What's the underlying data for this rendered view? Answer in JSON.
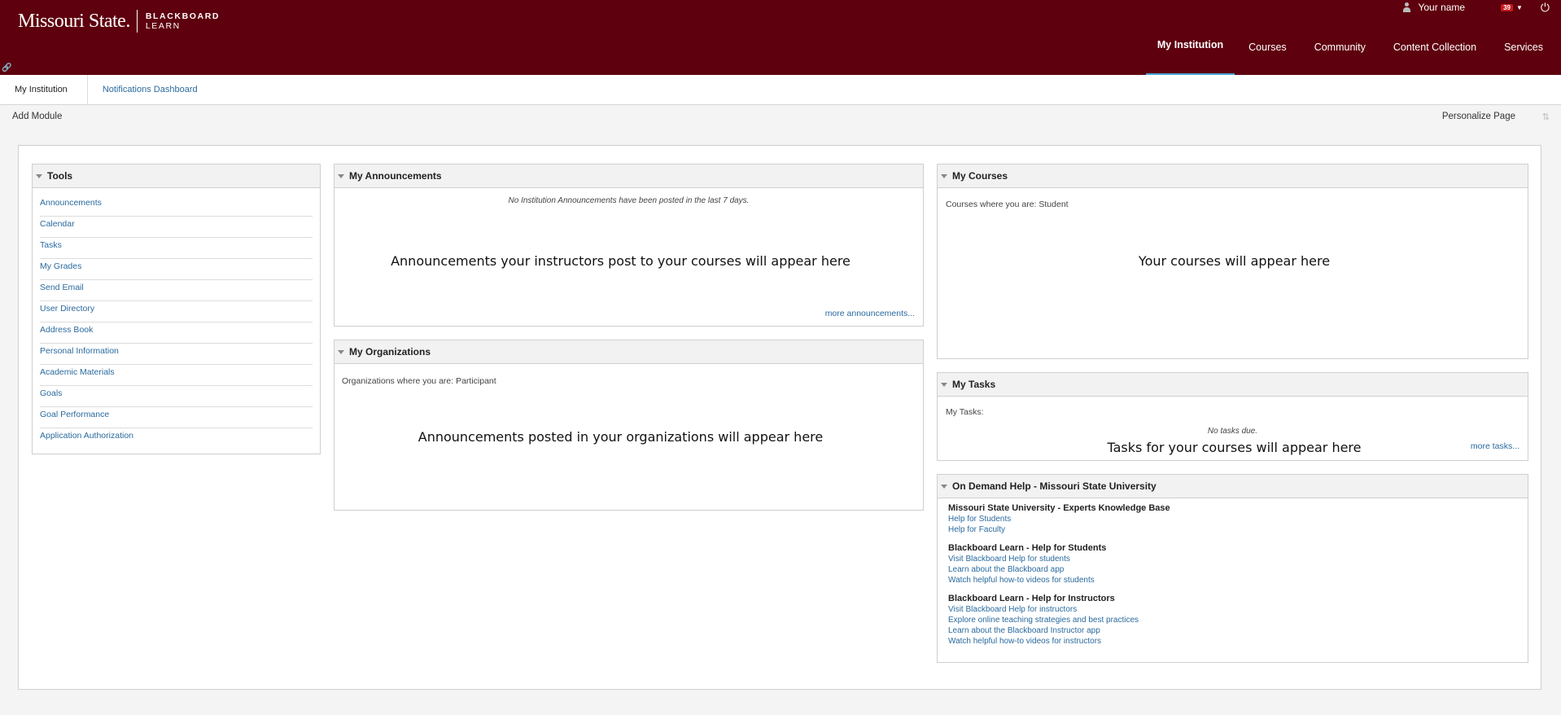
{
  "brand": {
    "wordmark": "Missouri State.",
    "product_top": "BLACKBOARD",
    "product_bottom": "LEARN",
    "colors": {
      "header_bg": "#5e000e",
      "link": "#2a6a9e",
      "active_underline": "#4aa3d8",
      "badge": "#c7161d"
    }
  },
  "user": {
    "name": "Your name",
    "notifications": "39"
  },
  "main_nav": [
    {
      "label": "My Institution"
    },
    {
      "label": "Courses"
    },
    {
      "label": "Community"
    },
    {
      "label": "Content Collection"
    },
    {
      "label": "Services"
    }
  ],
  "sub_tabs": [
    {
      "label": "My Institution"
    },
    {
      "label": "Notifications Dashboard"
    }
  ],
  "actions": {
    "add_module": "Add Module",
    "personalize": "Personalize Page"
  },
  "tools": {
    "title": "Tools",
    "items": [
      "Announcements",
      "Calendar",
      "Tasks",
      "My Grades",
      "Send Email",
      "User Directory",
      "Address Book",
      "Personal Information",
      "Academic Materials",
      "Goals",
      "Goal Performance",
      "Application Authorization"
    ]
  },
  "announcements": {
    "title": "My Announcements",
    "note": "No Institution Announcements have been posted in the last 7 days.",
    "placeholder": "Announcements your instructors post to your courses will appear here",
    "more": "more announcements..."
  },
  "organizations": {
    "title": "My Organizations",
    "role_text": "Organizations where you are: Participant",
    "placeholder": "Announcements posted in your organizations will appear here"
  },
  "courses": {
    "title": "My Courses",
    "role_text": "Courses where you are: Student",
    "placeholder": "Your courses will appear here"
  },
  "tasks": {
    "title": "My Tasks",
    "label": "My Tasks:",
    "note": "No tasks due.",
    "placeholder": "Tasks for your courses will appear here",
    "more": "more tasks..."
  },
  "help": {
    "title": "On Demand Help - Missouri State University",
    "groups": [
      {
        "title": "Missouri State University - Experts Knowledge Base",
        "links": [
          "Help for Students",
          "Help for Faculty"
        ]
      },
      {
        "title": "Blackboard Learn - Help for Students",
        "links": [
          "Visit Blackboard Help for students",
          "Learn about the Blackboard app",
          "Watch helpful how-to videos for students"
        ]
      },
      {
        "title": "Blackboard Learn - Help for Instructors",
        "links": [
          "Visit Blackboard Help for instructors",
          "Explore online teaching strategies and best practices",
          "Learn about the Blackboard Instructor app",
          "Watch helpful how-to videos for instructors"
        ]
      }
    ]
  }
}
